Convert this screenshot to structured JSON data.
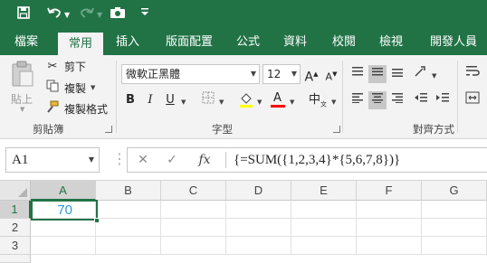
{
  "quick_access": {
    "save_icon": "save-icon",
    "undo_icon": "undo-icon",
    "redo_icon": "redo-icon",
    "camera_icon": "camera-icon",
    "customize_icon": "customize-icon"
  },
  "tabs": [
    "檔案",
    "常用",
    "插入",
    "版面配置",
    "公式",
    "資料",
    "校閱",
    "檢視",
    "開發人員"
  ],
  "active_tab": "常用",
  "ribbon": {
    "clipboard": {
      "paste_label": "貼上",
      "cut_label": "剪下",
      "copy_label": "複製",
      "format_painter_label": "複製格式",
      "group_label": "剪貼簿"
    },
    "font": {
      "font_name": "微軟正黑體",
      "font_size": "12",
      "bold_label": "B",
      "italic_label": "I",
      "underline_label": "U",
      "grow_label": "A",
      "shrink_label": "A",
      "font_color_label": "A",
      "phonetic_label": "中",
      "group_label": "字型",
      "font_color": "#ff0000",
      "fill_color": "#ffff00"
    },
    "alignment": {
      "group_label": "對齊方式"
    }
  },
  "formula_bar": {
    "name_box": "A1",
    "cancel_icon": "cancel-icon",
    "enter_icon": "enter-icon",
    "fx_label": "fx",
    "formula": "{=SUM({1,2,3,4}*{5,6,7,8})}"
  },
  "grid": {
    "columns": [
      "A",
      "B",
      "C",
      "D",
      "E",
      "F",
      "G"
    ],
    "rows": [
      "1",
      "2",
      "3"
    ],
    "cells": {
      "A1": "70"
    },
    "selected_cell": "A1",
    "value_color": "#2e9bd6",
    "accent_color": "#217346"
  },
  "colors": {
    "brand": "#217346",
    "ribbon_bg": "#f3f3f3"
  }
}
